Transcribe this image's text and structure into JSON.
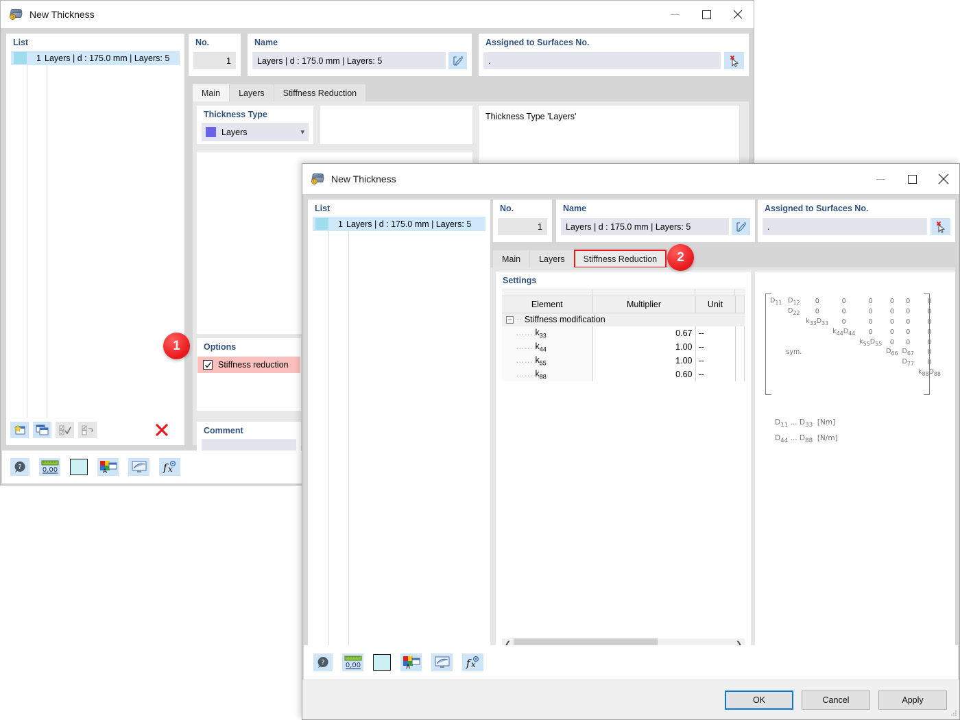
{
  "dialog1": {
    "title": "New Thickness",
    "window_controls": {
      "minimize": "minimize-icon",
      "maximize": "maximize-icon",
      "close": "close-icon"
    },
    "list": {
      "title": "List",
      "rows": [
        {
          "num": "1",
          "label": "Layers | d : 175.0 mm | Layers: 5"
        }
      ]
    },
    "no": {
      "title": "No.",
      "value": "1"
    },
    "name": {
      "title": "Name",
      "value": "Layers | d : 175.0 mm | Layers: 5"
    },
    "assigned": {
      "title": "Assigned to Surfaces No.",
      "value": "."
    },
    "tabs": [
      {
        "label": "Main",
        "active": true
      },
      {
        "label": "Layers",
        "active": false
      },
      {
        "label": "Stiffness Reduction",
        "active": false
      }
    ],
    "thickness_type": {
      "title": "Thickness Type",
      "value": "Layers"
    },
    "info_panel": {
      "text": "Thickness Type  'Layers'"
    },
    "options": {
      "title": "Options",
      "checkbox_label": "Stiffness reduction",
      "checked": true
    },
    "comment": {
      "title": "Comment",
      "value": ""
    },
    "list_toolbar": [
      "new-icon",
      "copy-icon",
      "select-all-icon",
      "invert-selection-icon",
      "delete-icon"
    ],
    "status_toolbar": [
      "help-icon",
      "units-icon",
      "color-swatch-icon",
      "text-format-icon",
      "display-icon",
      "formula-icon"
    ]
  },
  "dialog2": {
    "title": "New Thickness",
    "window_controls": {
      "minimize": "minimize-icon",
      "maximize": "maximize-icon",
      "close": "close-icon"
    },
    "list": {
      "title": "List",
      "rows": [
        {
          "num": "1",
          "label": "Layers | d : 175.0 mm | Layers: 5"
        }
      ]
    },
    "no": {
      "title": "No.",
      "value": "1"
    },
    "name": {
      "title": "Name",
      "value": "Layers | d : 175.0 mm | Layers: 5"
    },
    "assigned": {
      "title": "Assigned to Surfaces No.",
      "value": "."
    },
    "tabs": [
      {
        "label": "Main",
        "active": false
      },
      {
        "label": "Layers",
        "active": false
      },
      {
        "label": "Stiffness Reduction",
        "active": true,
        "highlighted": true
      }
    ],
    "settings": {
      "title": "Settings",
      "columns": [
        "Element",
        "Multiplier",
        "Unit"
      ],
      "group_row": "Stiffness modification",
      "rows": [
        {
          "element": "k",
          "sub": "33",
          "multiplier": "0.67",
          "unit": "--"
        },
        {
          "element": "k",
          "sub": "44",
          "multiplier": "1.00",
          "unit": "--"
        },
        {
          "element": "k",
          "sub": "55",
          "multiplier": "1.00",
          "unit": "--"
        },
        {
          "element": "k",
          "sub": "88",
          "multiplier": "0.60",
          "unit": "--"
        }
      ]
    },
    "matrix": {
      "rows": [
        [
          "D|11",
          "D|12",
          "0",
          "0",
          "0",
          "0",
          "0",
          "0"
        ],
        [
          "",
          "D|22",
          "0",
          "0",
          "0",
          "0",
          "0",
          "0"
        ],
        [
          "",
          "",
          "k|33D|33",
          "0",
          "0",
          "0",
          "0",
          "0"
        ],
        [
          "",
          "",
          "",
          "k|44D|44",
          "0",
          "0",
          "0",
          "0"
        ],
        [
          "",
          "",
          "",
          "",
          "k|55D|55",
          "0",
          "0",
          "0"
        ],
        [
          "",
          "sym.",
          "",
          "",
          "",
          "D|66",
          "D|67",
          "0"
        ],
        [
          "",
          "",
          "",
          "",
          "",
          "",
          "D|77",
          "0"
        ],
        [
          "",
          "",
          "",
          "",
          "",
          "",
          "",
          "k|88D|88"
        ]
      ],
      "legend": [
        {
          "from": "D|11",
          "ellipsis": "...",
          "to": "D|33",
          "unit": "[Nm]"
        },
        {
          "from": "D|44",
          "ellipsis": "...",
          "to": "D|88",
          "unit": "[N/m]"
        }
      ]
    },
    "grid_toolbar": [
      "import-icon",
      "export-icon",
      "excel-import-icon",
      "excel-export-icon",
      "info-icon"
    ],
    "matrix_toolbar": [
      "copy-image-icon"
    ],
    "list_toolbar": [
      "new-icon",
      "copy-icon",
      "select-all-icon",
      "invert-selection-icon",
      "delete-icon"
    ],
    "status_toolbar": [
      "help-icon",
      "units-icon",
      "color-swatch-icon",
      "text-format-icon",
      "display-icon",
      "formula-icon"
    ],
    "buttons": {
      "ok": "OK",
      "cancel": "Cancel",
      "apply": "Apply"
    }
  },
  "annotations": [
    {
      "id": "1",
      "target": "stiffness-reduction-checkbox"
    },
    {
      "id": "2",
      "target": "stiffness-reduction-tab"
    }
  ],
  "colors": {
    "accent_blue": "#31527e",
    "highlight_red": "#e8191c",
    "checkbox_highlight": "#fac0bd",
    "selection_blue": "#cfe8fa",
    "button_blue": "#0078d7"
  }
}
